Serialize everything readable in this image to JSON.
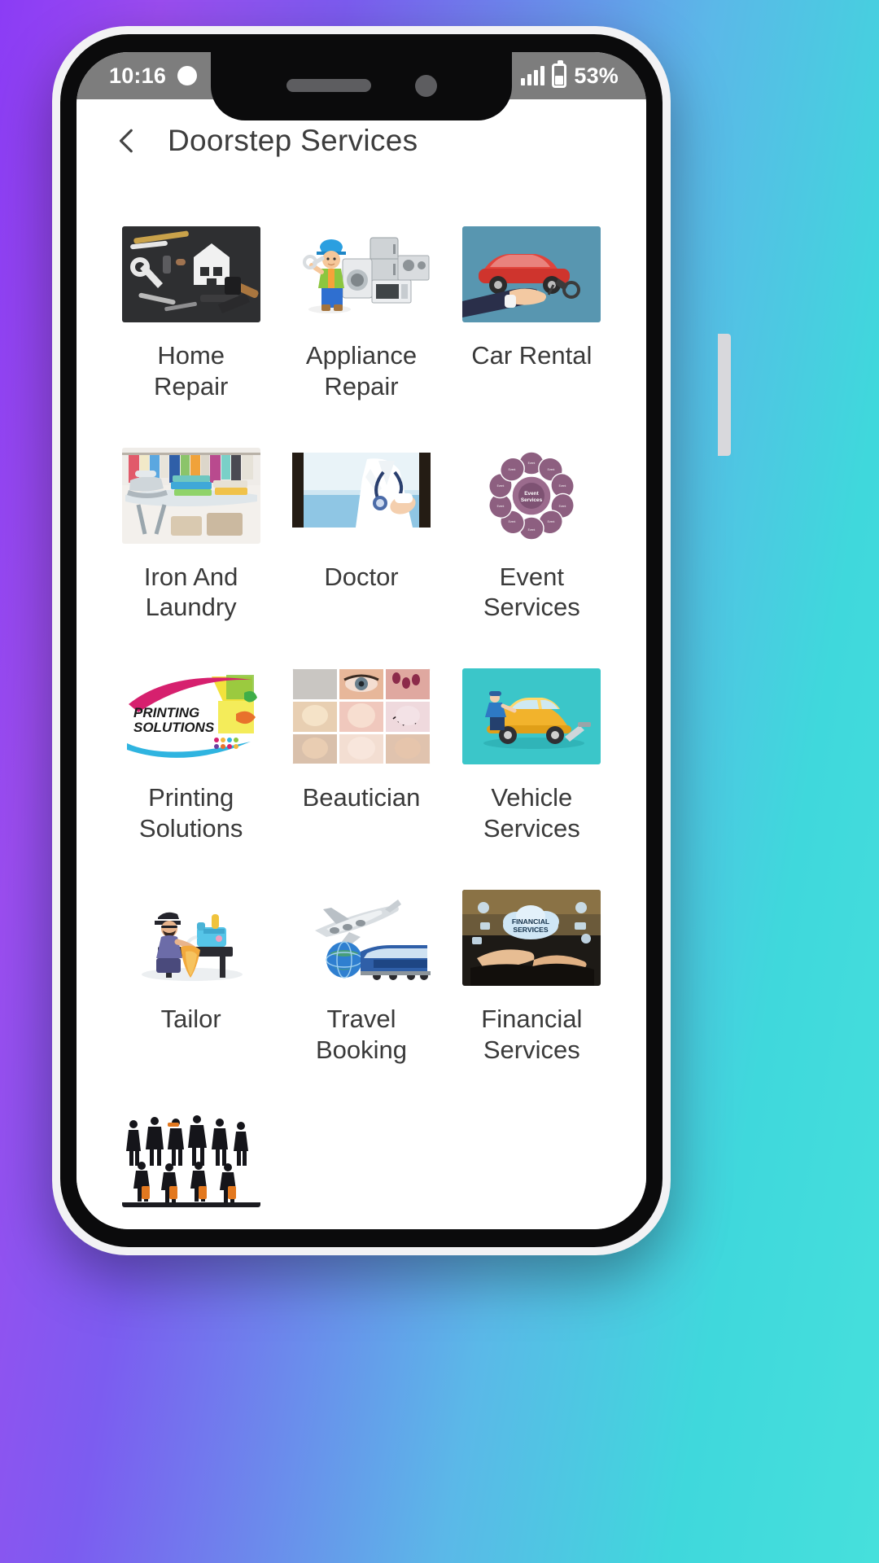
{
  "status_bar": {
    "time": "10:16",
    "battery_percent": "53%",
    "icons": [
      "clock-icon",
      "signal-icon",
      "battery-icon"
    ]
  },
  "header": {
    "back_icon": "chevron-left-icon",
    "title": "Doorstep Services"
  },
  "services": [
    {
      "label": "Home\nRepair",
      "label_line1": "Home",
      "label_line2": "Repair",
      "icon": "home-repair-tools-image"
    },
    {
      "label": "Appliance\nRepair",
      "label_line1": "Appliance",
      "label_line2": "Repair",
      "icon": "appliance-repair-image"
    },
    {
      "label": "Car Rental",
      "label_line1": "Car Rental",
      "label_line2": "",
      "icon": "car-rental-image"
    },
    {
      "label": "Iron And\nLaundry",
      "label_line1": "Iron And",
      "label_line2": "Laundry",
      "icon": "iron-laundry-image"
    },
    {
      "label": "Doctor",
      "label_line1": "Doctor",
      "label_line2": "",
      "icon": "doctor-stethoscope-image"
    },
    {
      "label": "Event\nServices",
      "label_line1": "Event",
      "label_line2": "Services",
      "icon": "event-services-diagram-image"
    },
    {
      "label": "Printing\nSolutions",
      "label_line1": "Printing",
      "label_line2": "Solutions",
      "icon": "printing-solutions-logo-image"
    },
    {
      "label": "Beautician",
      "label_line1": "Beautician",
      "label_line2": "",
      "icon": "beautician-collage-image"
    },
    {
      "label": "Vehicle\nServices",
      "label_line1": "Vehicle",
      "label_line2": "Services",
      "icon": "vehicle-services-image"
    },
    {
      "label": "Tailor",
      "label_line1": "Tailor",
      "label_line2": "",
      "icon": "tailor-sewing-image"
    },
    {
      "label": "Travel\nBooking",
      "label_line1": "Travel",
      "label_line2": "Booking",
      "icon": "travel-booking-image"
    },
    {
      "label": "Financial\nServices",
      "label_line1": "Financial",
      "label_line2": "Services",
      "icon": "financial-services-image"
    },
    {
      "label": "",
      "label_line1": "",
      "label_line2": "",
      "icon": "security-guards-silhouette-image"
    }
  ],
  "event_services_diagram": {
    "center_label": "Event\nServices",
    "center_line1": "Event",
    "center_line2": "Services"
  },
  "printing_logo": {
    "line1": "PRINTING",
    "line2": "SOLUTIONS"
  },
  "financial_logo": {
    "line1": "FINANCIAL",
    "line2": "SERVICES"
  },
  "colors": {
    "bg_gradient_start": "#8B3CF5",
    "bg_gradient_end": "#46E0DC",
    "status_bar_bg": "#7d7d7d",
    "screen_bg": "#ffffff",
    "title_text": "#3d3d3d",
    "label_text": "#3a3a3a",
    "car_rental_bg": "#5896b0",
    "vehicle_services_bg": "#3bc6c9",
    "event_services_purple": "#8d5f80"
  }
}
